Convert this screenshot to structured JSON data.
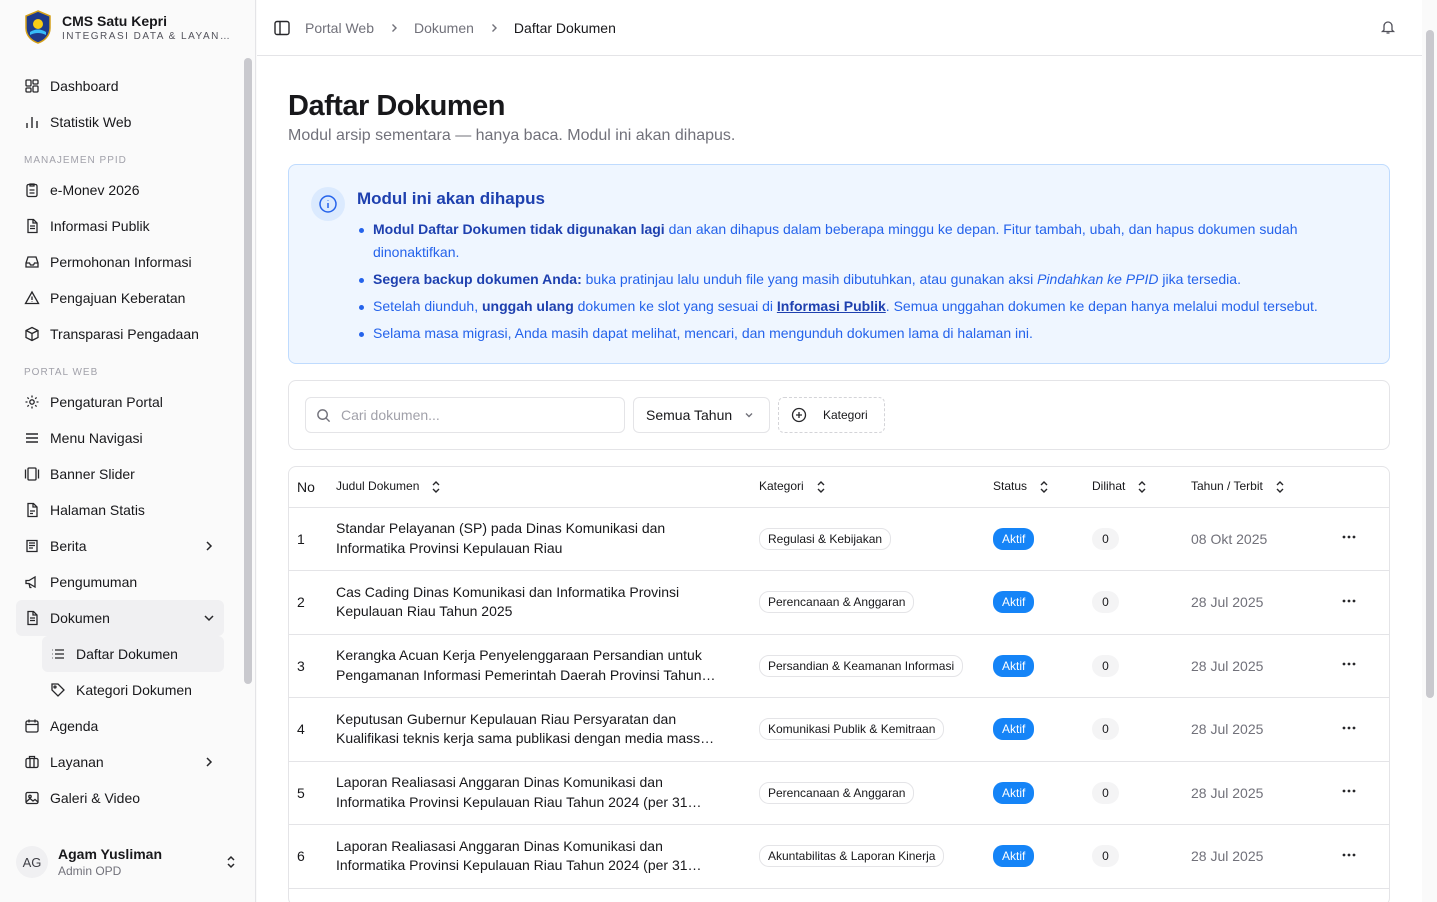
{
  "brand": {
    "title": "CMS Satu Kepri",
    "subtitle": "INTEGRASI DATA & LAYANAN PUBLIK"
  },
  "sidebar": {
    "top_items": [
      {
        "label": "Dashboard",
        "icon": "dashboard-icon"
      },
      {
        "label": "Statistik Web",
        "icon": "bar-chart-icon"
      }
    ],
    "section_ppid": "MANAJEMEN PPID",
    "ppid_items": [
      {
        "label": "e-Monev 2026",
        "icon": "clipboard-icon"
      },
      {
        "label": "Informasi Publik",
        "icon": "file-text-icon"
      },
      {
        "label": "Permohonan Informasi",
        "icon": "inbox-icon"
      },
      {
        "label": "Pengajuan Keberatan",
        "icon": "alert-triangle-icon"
      },
      {
        "label": "Transparasi Pengadaan",
        "icon": "package-icon"
      }
    ],
    "section_portal": "PORTAL WEB",
    "portal_items": [
      {
        "label": "Pengaturan Portal",
        "icon": "gear-icon"
      },
      {
        "label": "Menu Navigasi",
        "icon": "menu-icon"
      },
      {
        "label": "Banner Slider",
        "icon": "gallery-icon"
      },
      {
        "label": "Halaman Statis",
        "icon": "file-icon"
      },
      {
        "label": "Berita",
        "icon": "newspaper-icon"
      },
      {
        "label": "Pengumuman",
        "icon": "megaphone-icon"
      },
      {
        "label": "Dokumen",
        "icon": "file-text-icon"
      }
    ],
    "dokumen_sub": [
      {
        "label": "Daftar Dokumen",
        "icon": "list-icon"
      },
      {
        "label": "Kategori Dokumen",
        "icon": "tag-icon"
      }
    ],
    "bottom_items": [
      {
        "label": "Agenda",
        "icon": "calendar-icon"
      },
      {
        "label": "Layanan",
        "icon": "briefcase-icon"
      },
      {
        "label": "Galeri & Video",
        "icon": "image-icon"
      }
    ]
  },
  "user": {
    "initials": "AG",
    "name": "Agam Yusliman",
    "role": "Admin OPD"
  },
  "breadcrumb": {
    "item1": "Portal Web",
    "item2": "Dokumen",
    "current": "Daftar Dokumen"
  },
  "page": {
    "title": "Daftar Dokumen",
    "subtitle": "Modul arsip sementara — hanya baca. Modul ini akan dihapus."
  },
  "alert": {
    "title": "Modul ini akan dihapus",
    "b1_strong": "Modul Daftar Dokumen tidak digunakan lagi",
    "b1_rest": " dan akan dihapus dalam beberapa minggu ke depan. Fitur tambah, ubah, dan hapus dokumen sudah dinonaktifkan.",
    "b2_strong": "Segera backup dokumen Anda:",
    "b2_rest": " buka pratinjau lalu unduh file yang masih dibutuhkan, atau gunakan aksi ",
    "b2_italic": "Pindahkan ke PPID",
    "b2_end": " jika tersedia.",
    "b3_start": "Setelah diunduh, ",
    "b3_strong": "unggah ulang",
    "b3_mid": " dokumen ke slot yang sesuai di ",
    "b3_link": "Informasi Publik",
    "b3_end": ". Semua unggahan dokumen ke depan hanya melalui modul tersebut.",
    "b4": "Selama masa migrasi, Anda masih dapat melihat, mencari, dan mengunduh dokumen lama di halaman ini."
  },
  "filters": {
    "search_placeholder": "Cari dokumen...",
    "search_value": "",
    "year_selected": "Semua Tahun",
    "category_button": "Kategori"
  },
  "table": {
    "headers": {
      "no": "No",
      "judul": "Judul Dokumen",
      "kategori": "Kategori",
      "status": "Status",
      "dilihat": "Dilihat",
      "tahun": "Tahun / Terbit"
    },
    "rows": [
      {
        "no": "1",
        "judul": "Standar Pelayanan (SP) pada Dinas Komunikasi dan Informatika Provinsi Kepulauan Riau",
        "kategori": "Regulasi & Kebijakan",
        "status": "Aktif",
        "dilihat": "0",
        "tahun": "08 Okt 2025"
      },
      {
        "no": "2",
        "judul": "Cas Cading Dinas Komunikasi dan Informatika Provinsi Kepulauan Riau Tahun 2025",
        "kategori": "Perencanaan & Anggaran",
        "status": "Aktif",
        "dilihat": "0",
        "tahun": "28 Jul 2025"
      },
      {
        "no": "3",
        "judul": "Kerangka Acuan Kerja Penyelenggaraan Persandian untuk Pengamanan Informasi Pemerintah Daerah Provinsi Tahun…",
        "kategori": "Persandian & Keamanan Informasi",
        "status": "Aktif",
        "dilihat": "0",
        "tahun": "28 Jul 2025"
      },
      {
        "no": "4",
        "judul": "Keputusan Gubernur Kepulauan Riau Persyaratan dan Kualifikasi teknis kerja sama publikasi dengan media mass…",
        "kategori": "Komunikasi Publik & Kemitraan",
        "status": "Aktif",
        "dilihat": "0",
        "tahun": "28 Jul 2025"
      },
      {
        "no": "5",
        "judul": "Laporan Realiasasi Anggaran Dinas Komunikasi dan Informatika Provinsi Kepulauan Riau Tahun 2024 (per 31…",
        "kategori": "Perencanaan & Anggaran",
        "status": "Aktif",
        "dilihat": "0",
        "tahun": "28 Jul 2025"
      },
      {
        "no": "6",
        "judul": "Laporan Realiasasi Anggaran Dinas Komunikasi dan Informatika Provinsi Kepulauan Riau Tahun 2024 (per 31…",
        "kategori": "Akuntabilitas & Laporan Kinerja",
        "status": "Aktif",
        "dilihat": "0",
        "tahun": "28 Jul 2025"
      }
    ]
  },
  "colors": {
    "accent": "#1584f7",
    "alert_bg": "#eff6ff",
    "alert_text": "#2563eb"
  }
}
